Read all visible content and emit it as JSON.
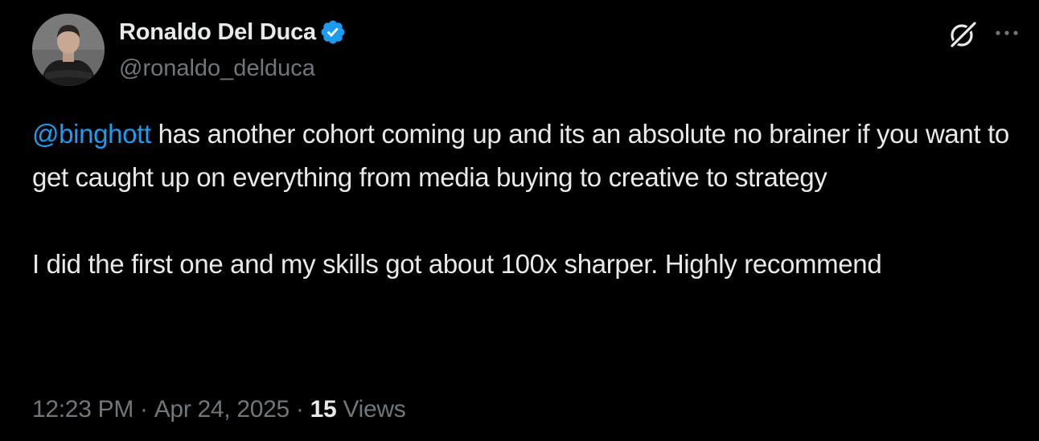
{
  "author": {
    "display_name": "Ronaldo Del Duca",
    "handle": "@ronaldo_delduca",
    "verified": true,
    "verified_color": "#1d9bf0"
  },
  "icons": {
    "grok": "grok-icon",
    "more": "more-options-icon",
    "verified": "verified-badge-icon",
    "avatar": "avatar"
  },
  "tweet": {
    "mention": "@binghott",
    "paragraph1_rest": " has another cohort coming up and its an absolute no brainer if you want to get caught up on everything from media buying to creative to strategy",
    "paragraph2": "I did the first one and my skills got about 100x sharper. Highly recommend"
  },
  "meta": {
    "time": "12:23 PM",
    "separator": "·",
    "date": "Apr 24, 2025",
    "views_count": "15",
    "views_label": "Views"
  },
  "colors": {
    "background": "#000000",
    "text_primary": "#e7e9ea",
    "text_secondary": "#71767b",
    "link": "#1d9bf0"
  }
}
